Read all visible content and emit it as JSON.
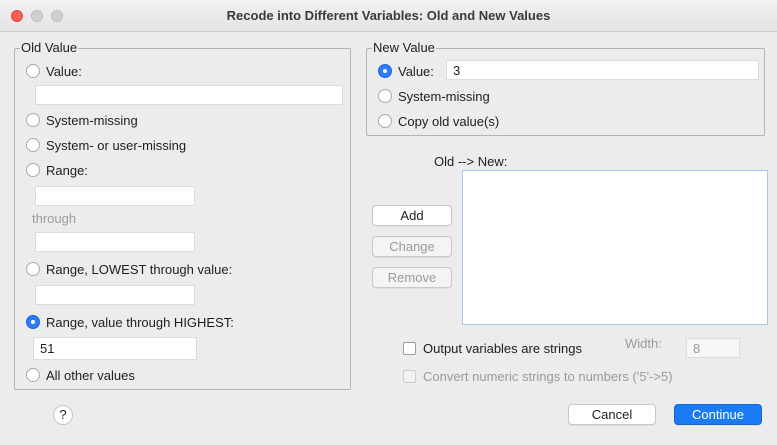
{
  "window": {
    "title": "Recode into Different Variables: Old and New Values"
  },
  "old_value": {
    "legend": "Old Value",
    "value_label": "Value:",
    "value_input": "",
    "system_missing": "System-missing",
    "system_or_user_missing": "System- or user-missing",
    "range_label": "Range:",
    "range_from": "",
    "through_label": "through",
    "range_to": "",
    "range_lowest_label": "Range, LOWEST through value:",
    "range_lowest_input": "",
    "range_highest_label": "Range, value through HIGHEST:",
    "range_highest_input": "51",
    "all_other": "All other values",
    "selected": "range_highest"
  },
  "new_value": {
    "legend": "New Value",
    "value_label": "Value:",
    "value_input": "3",
    "system_missing": "System-missing",
    "copy_old": "Copy old value(s)",
    "selected": "value"
  },
  "mapping": {
    "label": "Old --> New:",
    "items": [],
    "add": "Add",
    "change": "Change",
    "remove": "Remove"
  },
  "options": {
    "output_strings": "Output variables are strings",
    "width_label": "Width:",
    "width_value": "8",
    "convert_numeric": "Convert numeric strings to numbers ('5'->5)"
  },
  "footer": {
    "help": "?",
    "cancel": "Cancel",
    "continue": "Continue"
  },
  "colors": {
    "accent": "#1a7cf5",
    "window_bg": "#ececec"
  }
}
